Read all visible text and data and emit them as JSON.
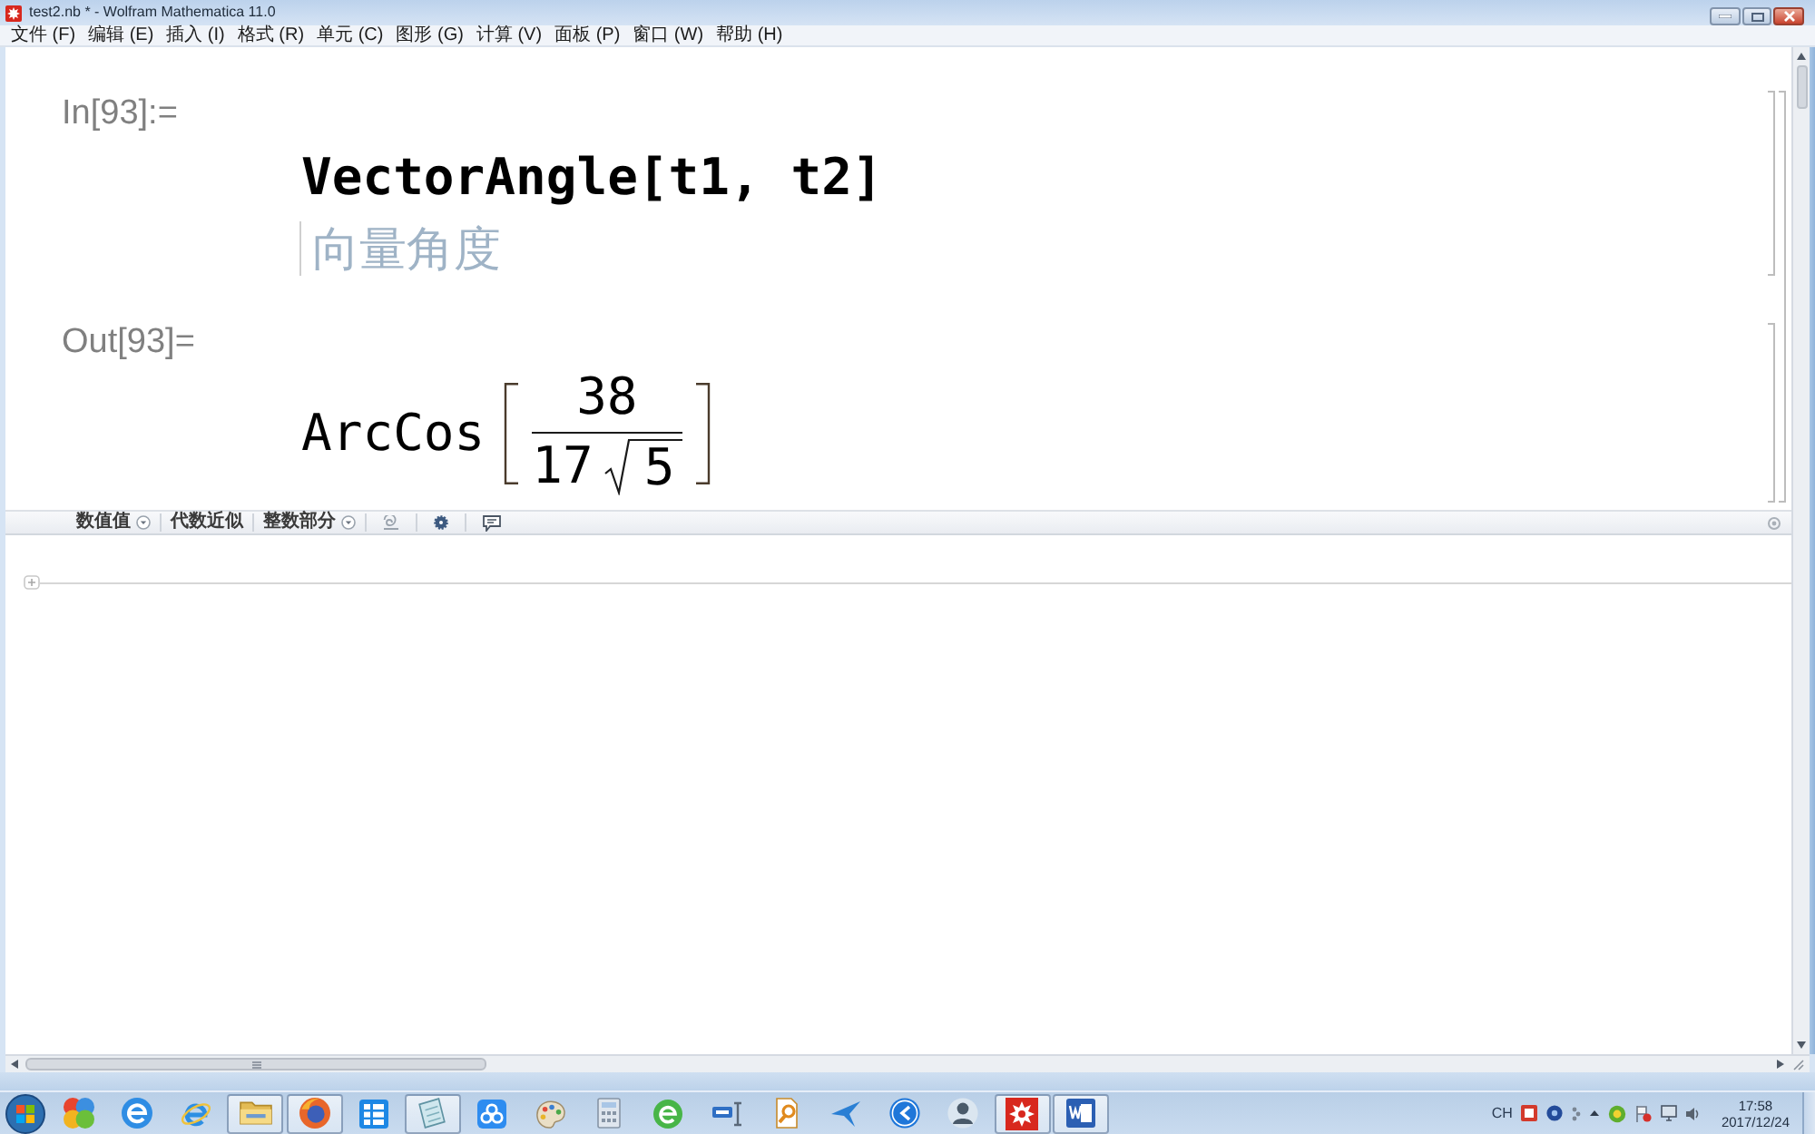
{
  "window": {
    "title": "test2.nb * - Wolfram Mathematica 11.0"
  },
  "menu": [
    "文件 (F)",
    "编辑 (E)",
    "插入 (I)",
    "格式 (R)",
    "单元 (C)",
    "图形 (G)",
    "计算 (V)",
    "面板 (P)",
    "窗口 (W)",
    "帮助 (H)"
  ],
  "cells": [
    {
      "kind": "input",
      "label": "In[93]:=",
      "code": "VectorAngle[t1, t2]",
      "annotation": "向量角度"
    },
    {
      "kind": "output",
      "label": "Out[93]=",
      "head": "ArcCos",
      "numerator": "38",
      "denominator": "17",
      "radicand": "5"
    }
  ],
  "suggestions_bar": {
    "items": [
      {
        "label": "数值值",
        "dropdown": true
      },
      {
        "label": "代数近似",
        "dropdown": false
      },
      {
        "label": "整数部分",
        "dropdown": true
      }
    ]
  },
  "taskbar": {
    "buttons": [
      {
        "running": false
      },
      {
        "running": false
      },
      {
        "running": false
      },
      {
        "running": true
      },
      {
        "running": true
      },
      {
        "running": false
      },
      {
        "running": true
      },
      {
        "running": false
      },
      {
        "running": false
      },
      {
        "running": false
      },
      {
        "running": false
      },
      {
        "running": false
      },
      {
        "running": false
      },
      {
        "running": false
      },
      {
        "running": false
      },
      {
        "running": false
      },
      {
        "running": true
      },
      {
        "running": true
      }
    ],
    "tray": {
      "language": "CH",
      "time": "17:58",
      "date": "2017/12/24"
    }
  }
}
